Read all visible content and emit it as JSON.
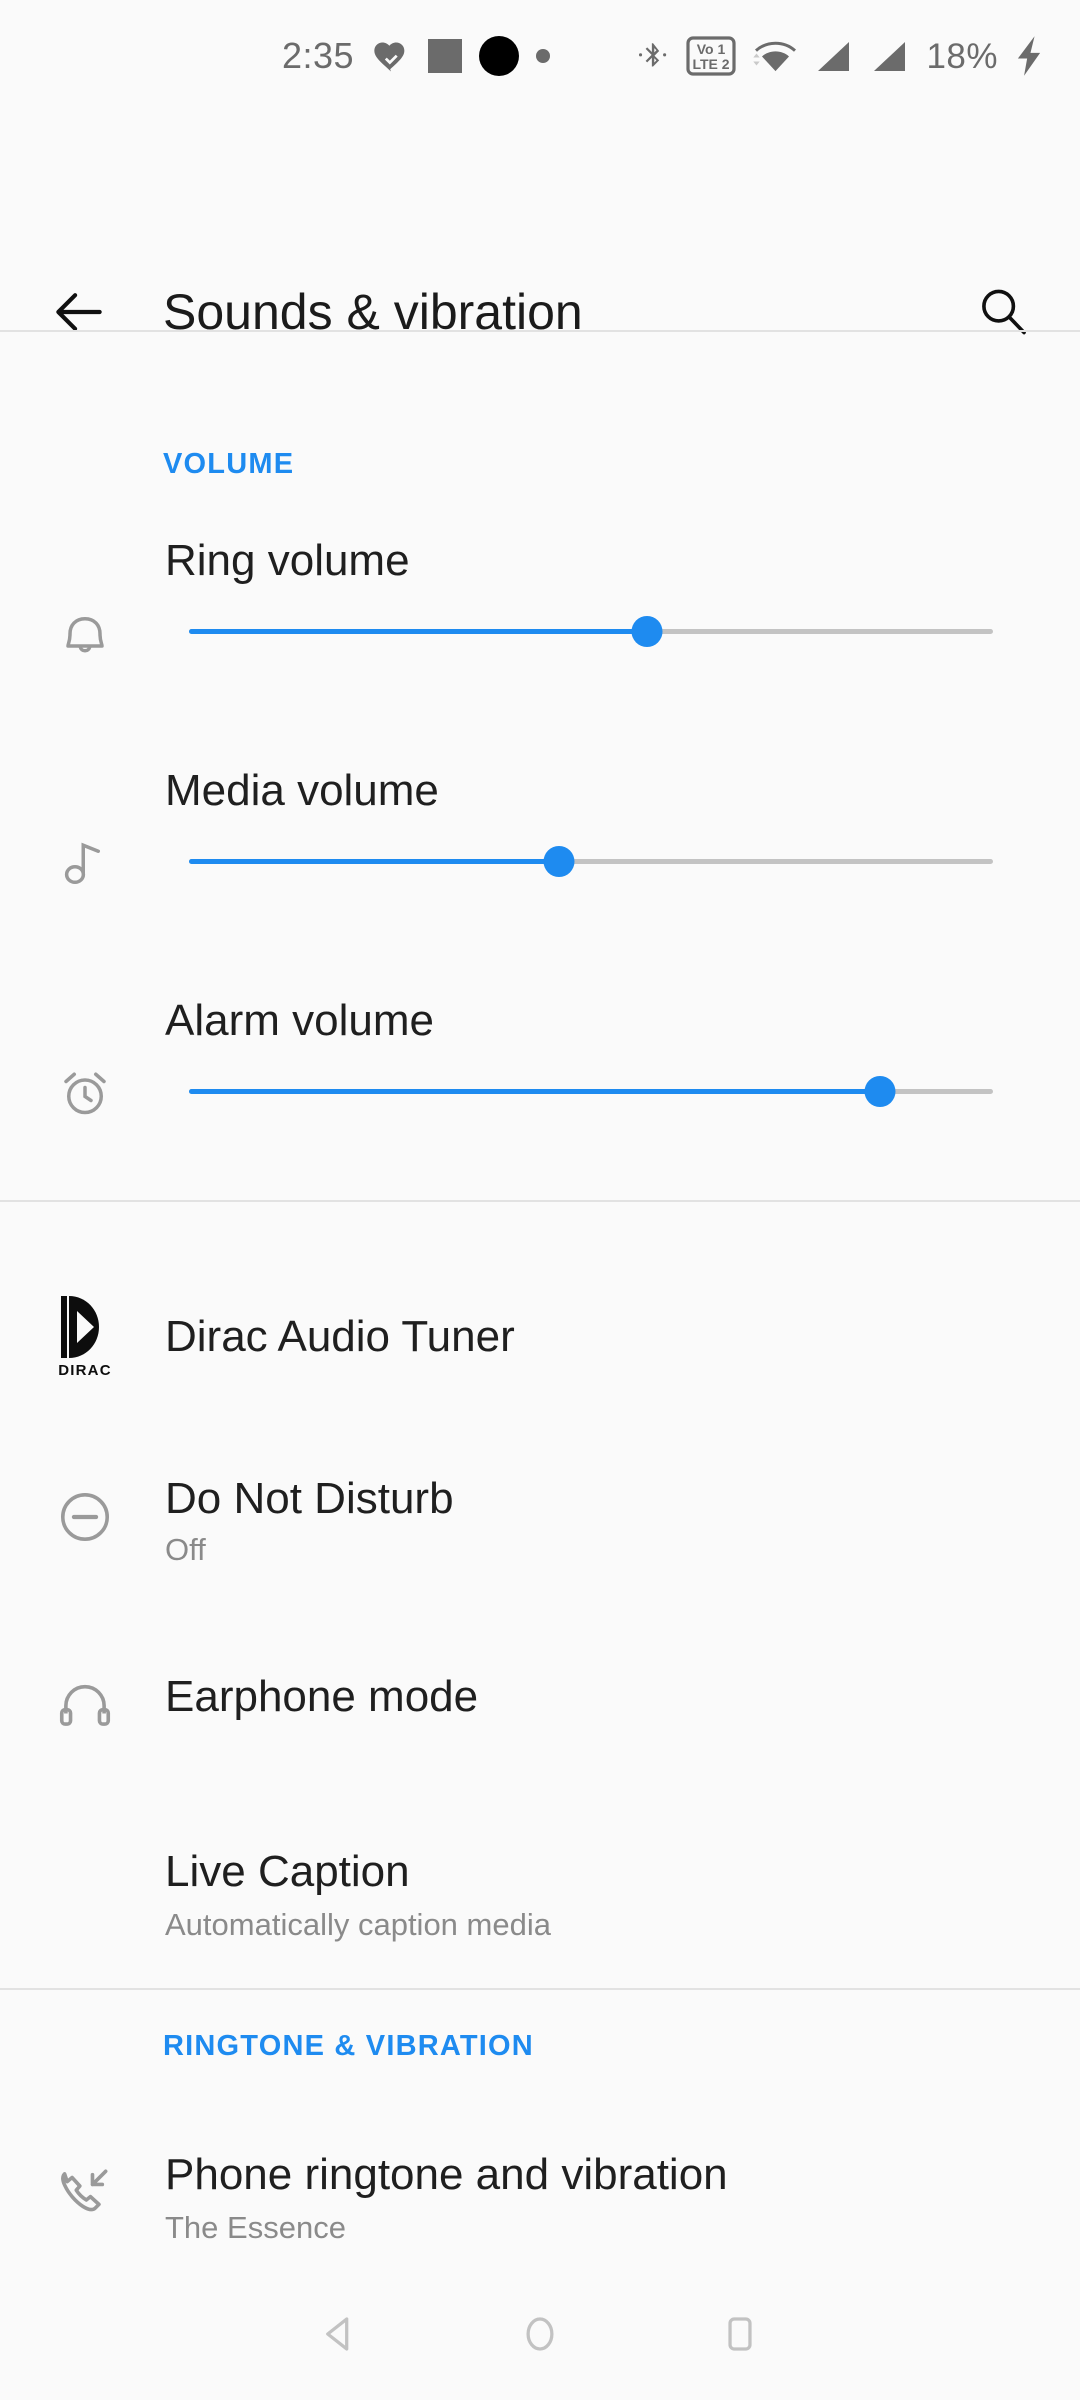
{
  "status_bar": {
    "time": "2:35",
    "battery_percent": "18%",
    "left_icons": [
      "heart-check-icon",
      "app-badge-square-icon",
      "black-circle-icon",
      "small-dot-icon"
    ],
    "right_icons": [
      "bluetooth-icon",
      "volte-icon",
      "wifi-icon",
      "signal-sim1-icon",
      "signal-sim2-icon",
      "charging-bolt-icon"
    ],
    "volte_label_top": "Vo  1",
    "volte_label_bottom": "LTE 2"
  },
  "app_bar": {
    "title": "Sounds & vibration",
    "back_icon": "arrow-left-icon",
    "search_icon": "search-icon"
  },
  "colors": {
    "accent_blue": "#1e8bf0",
    "background": "#fafafa",
    "primary_text": "#1f1f1f",
    "secondary_text": "#8a8a8a",
    "icon_grey": "#9a9a9a",
    "divider": "#e2e2e2",
    "track_grey": "#c3c3c3"
  },
  "sections": [
    {
      "header": "VOLUME",
      "sliders": [
        {
          "label": "Ring volume",
          "icon": "bell-icon",
          "value": 57
        },
        {
          "label": "Media volume",
          "icon": "music-note-icon",
          "value": 46
        },
        {
          "label": "Alarm volume",
          "icon": "alarm-clock-icon",
          "value": 86
        }
      ]
    },
    {
      "header": "",
      "items": [
        {
          "title": "Dirac Audio Tuner",
          "subtitle": "",
          "icon": "dirac-logo-icon",
          "logo_word": "DIRAC"
        },
        {
          "title": "Do Not Disturb",
          "subtitle": "Off",
          "icon": "do-not-disturb-icon"
        },
        {
          "title": "Earphone mode",
          "subtitle": "",
          "icon": "headphones-icon"
        },
        {
          "title": "Live Caption",
          "subtitle": "Automatically caption media",
          "icon": ""
        }
      ]
    },
    {
      "header": "RINGTONE & VIBRATION",
      "items": [
        {
          "title": "Phone ringtone and vibration",
          "subtitle": "The Essence",
          "icon": "incoming-call-icon"
        }
      ]
    }
  ],
  "nav_bar": {
    "back_label": "back-triangle-icon",
    "home_label": "home-circle-icon",
    "recents_label": "recents-square-icon"
  }
}
